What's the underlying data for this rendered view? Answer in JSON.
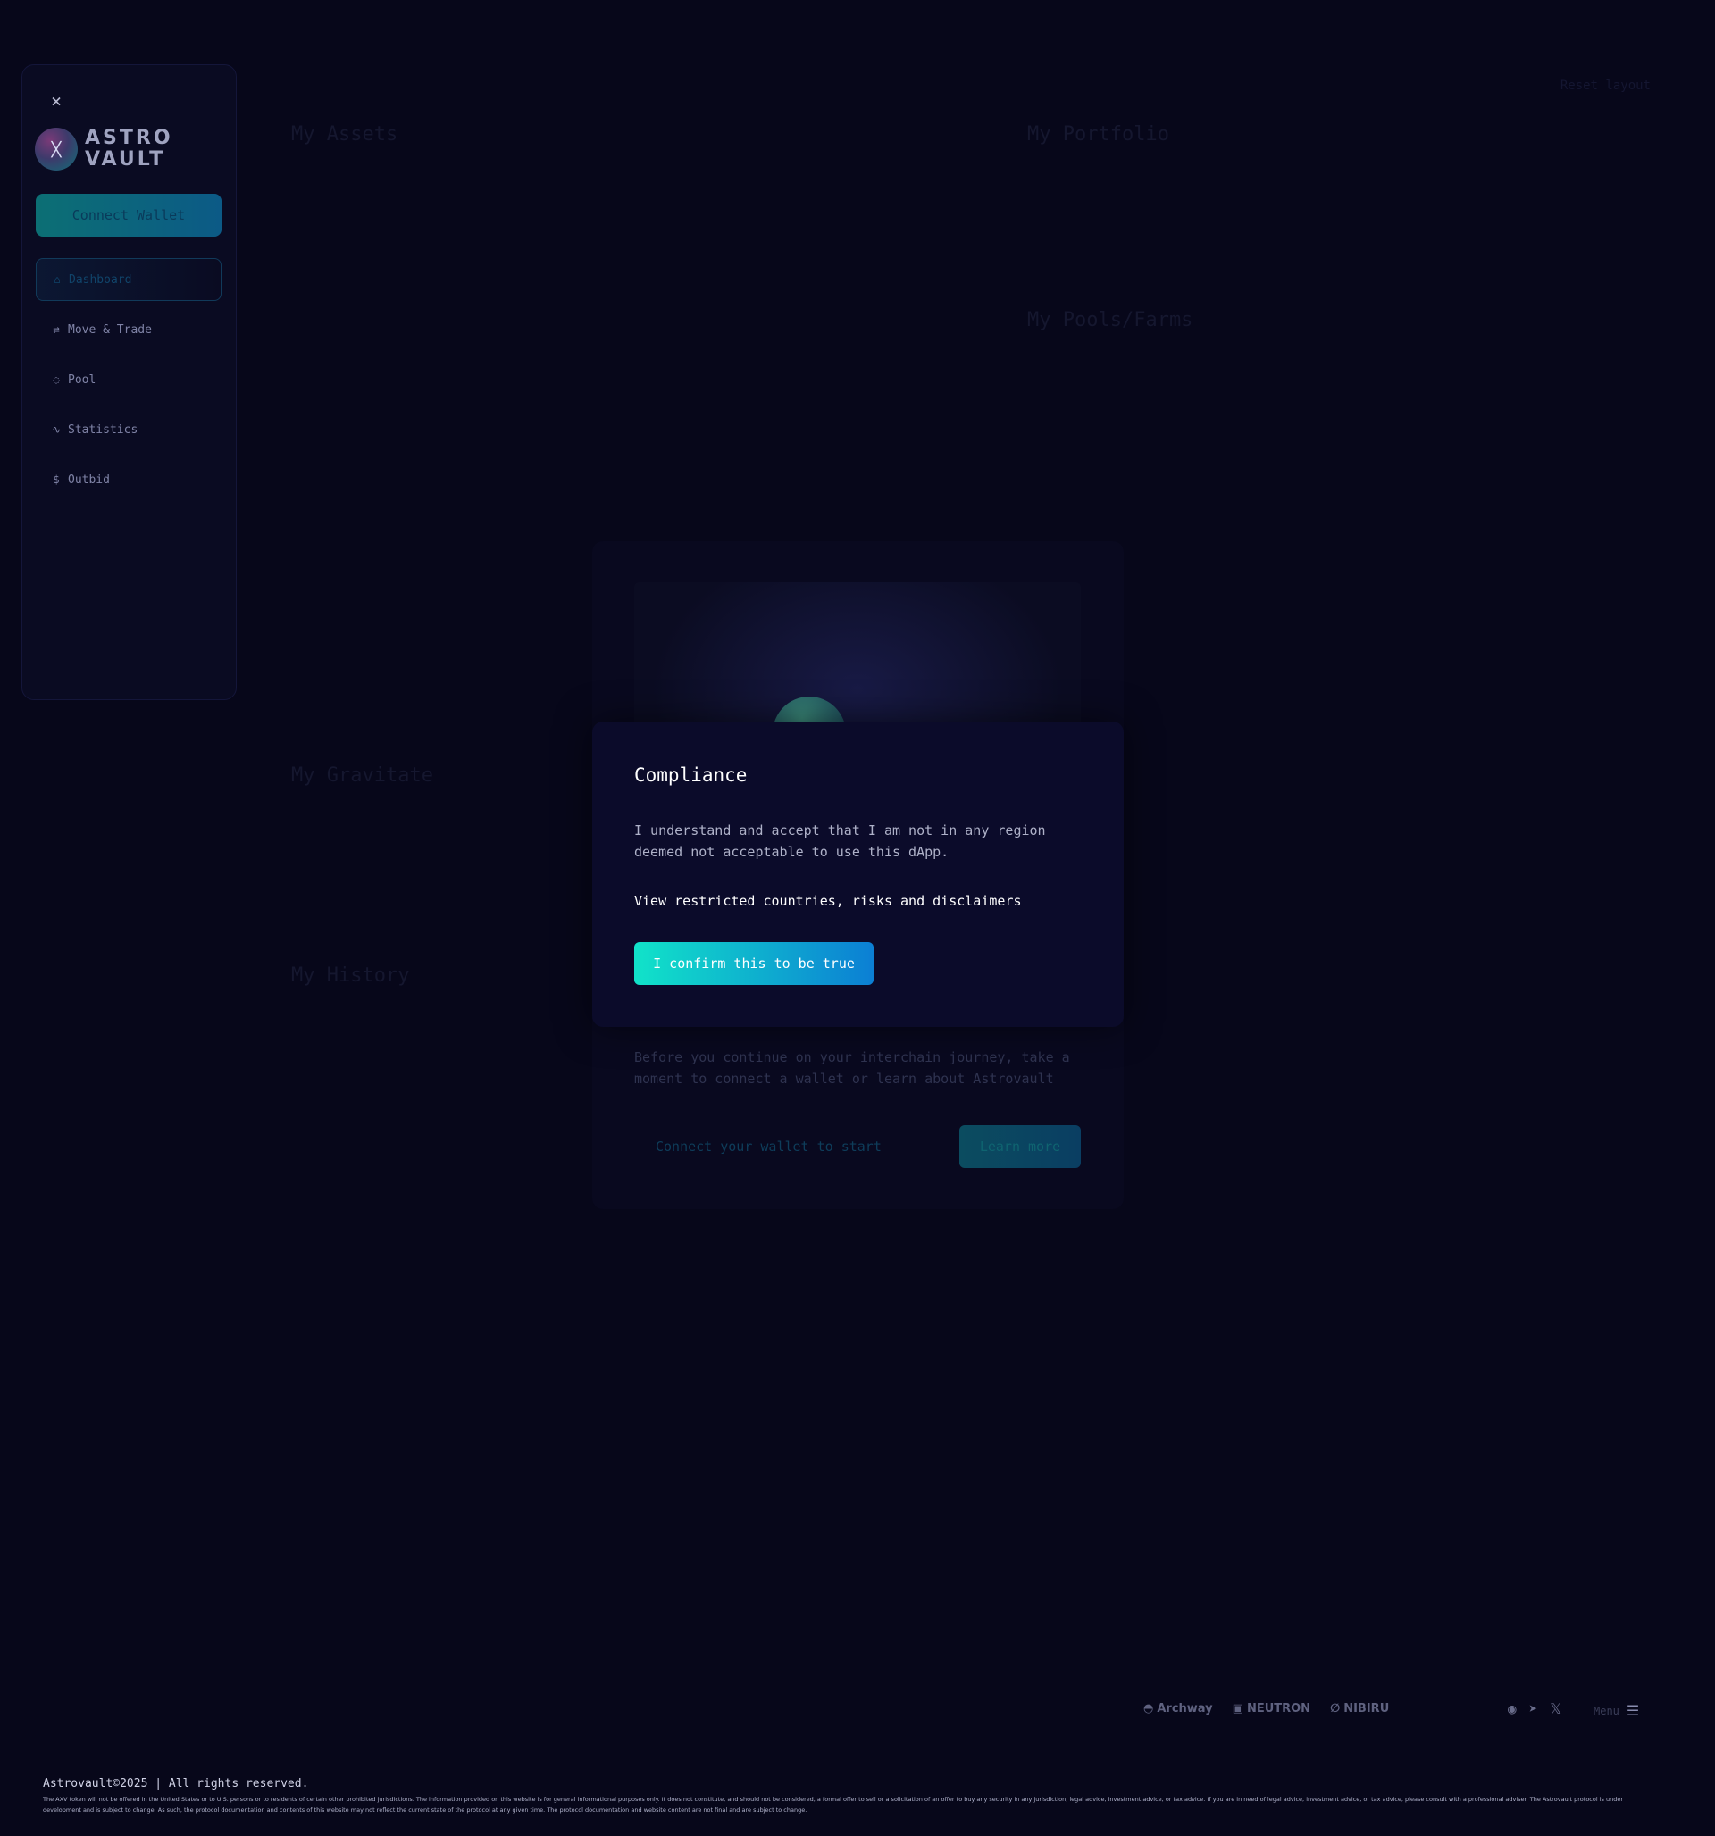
{
  "sidebar": {
    "close_icon": "×",
    "logo_mark": "ᚷ",
    "logo_line1": "ASTRO",
    "logo_line2": "VAULT",
    "connect_wallet": "Connect Wallet",
    "nav": [
      {
        "label": "Dashboard",
        "icon": "⌂",
        "icon_name": "home-icon",
        "active": true
      },
      {
        "label": "Move & Trade",
        "icon": "⇄",
        "icon_name": "swap-icon",
        "active": false
      },
      {
        "label": "Pool",
        "icon": "◌",
        "icon_name": "drop-icon",
        "active": false
      },
      {
        "label": "Statistics",
        "icon": "∿",
        "icon_name": "activity-icon",
        "active": false
      },
      {
        "label": "Outbid",
        "icon": "$",
        "icon_name": "dollar-icon",
        "active": false
      }
    ]
  },
  "background": {
    "reset_layout": "Reset layout",
    "my_assets": "My Assets",
    "my_portfolio": "My Portfolio",
    "my_pools_farms": "My Pools/Farms",
    "my_gravitate": "My Gravitate",
    "my_history": "My History"
  },
  "welcome": {
    "text": "Before you continue on your interchain journey, take a moment to connect a wallet or learn about Astrovault",
    "connect": "Connect your wallet to start",
    "learn_more": "Learn more"
  },
  "modal": {
    "title": "Compliance",
    "body": "I understand and accept that I am not in any region deemed not acceptable to use this dApp.",
    "link": "View restricted countries, risks and disclaimers",
    "confirm": "I confirm this to be true"
  },
  "partners": {
    "archway": "Archway",
    "neutron": "NEUTRON",
    "nibiru": "NIBIRU"
  },
  "socials": [
    {
      "name": "discord-icon",
      "glyph": "◉"
    },
    {
      "name": "telegram-icon",
      "glyph": "➤"
    },
    {
      "name": "x-icon",
      "glyph": "𝕏"
    }
  ],
  "menu": {
    "label": "Menu",
    "icon": "☰"
  },
  "footer": {
    "copyright": "Astrovault©2025 | All rights reserved.",
    "disclaimer": "The AXV token will not be offered in the United States or to U.S. persons or to residents of certain other prohibited jurisdictions. The information provided on this website is for general informational purposes only. It does not constitute, and should not be considered, a formal offer to sell or a solicitation of an offer to buy any security in any jurisdiction, legal advice, investment advice, or tax advice. If you are in need of legal advice, investment advice, or tax advice, please consult with a professional adviser. The Astrovault protocol is under development and is subject to change. As such, the protocol documentation and contents of this website may not reflect the current state of the protocol at any given time. The protocol documentation and website content are not final and are subject to change."
  }
}
